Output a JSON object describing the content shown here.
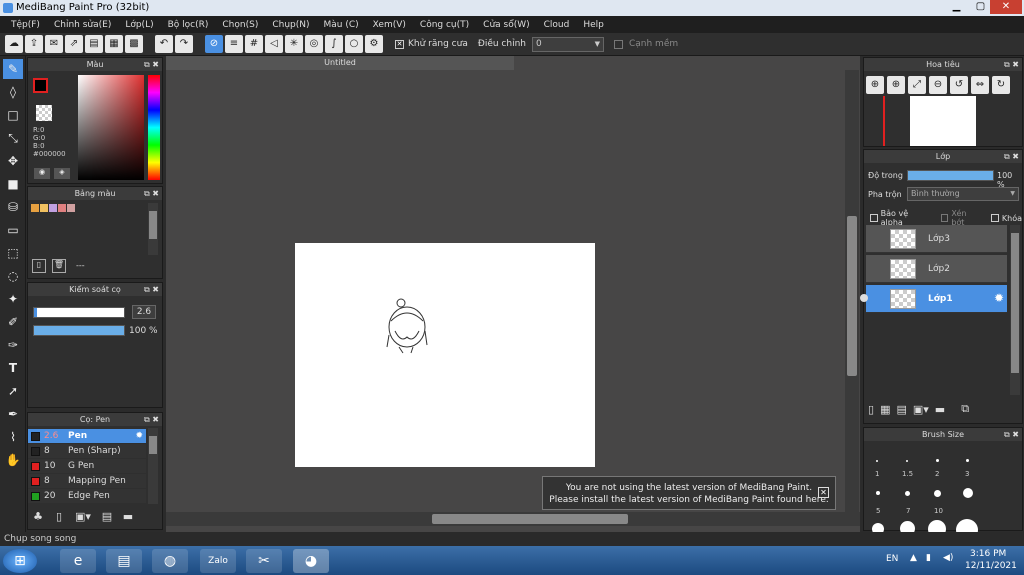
{
  "window": {
    "title": "MediBang Paint Pro (32bit)"
  },
  "menu": [
    "Tệp(F)",
    "Chỉnh sửa(E)",
    "Lớp(L)",
    "Bộ lọc(R)",
    "Chọn(S)",
    "Chụp(N)",
    "Màu (C)",
    "Xem(V)",
    "Công cụ(T)",
    "Cửa sổ(W)",
    "Cloud",
    "Help"
  ],
  "toolbar": {
    "antialias_label": "Khử răng cưa",
    "correction_label": "Điều chỉnh",
    "correction_value": "0",
    "soft_edge_label": "Cạnh mềm"
  },
  "color_panel": {
    "title": "Màu",
    "r": "R:0",
    "g": "G:0",
    "b": "B:0",
    "hex": "#000000"
  },
  "palette_panel": {
    "title": "Bảng màu",
    "dash": "---"
  },
  "brush_control": {
    "title": "Kiểm soát cọ",
    "size": "2.6",
    "opacity": "100 %"
  },
  "brush_list": {
    "title": "Cọ: Pen",
    "items": [
      {
        "size": "2.6",
        "name": "Pen",
        "color": "#222222"
      },
      {
        "size": "8",
        "name": "Pen (Sharp)",
        "color": "#222222"
      },
      {
        "size": "10",
        "name": "G Pen",
        "color": "#e02020"
      },
      {
        "size": "8",
        "name": "Mapping Pen",
        "color": "#e02020"
      },
      {
        "size": "20",
        "name": "Edge Pen",
        "color": "#20a020"
      }
    ]
  },
  "canvas": {
    "tab": "Untitled"
  },
  "notice": {
    "line1": "You are not using the latest version of MediBang Paint.",
    "line2": "Please install the latest version of MediBang Paint found here."
  },
  "navigator": {
    "title": "Hoa tiêu"
  },
  "layer_panel": {
    "title": "Lớp",
    "opacity_label": "Độ trong",
    "opacity_value": "100 %",
    "blend_label": "Pha trộn",
    "blend_value": "Bình thường",
    "protect_alpha": "Bảo vệ alpha",
    "clipping": "Xén bớt",
    "lock": "Khóa",
    "layers": [
      "Lớp3",
      "Lớp2",
      "Lớp1"
    ]
  },
  "brush_size": {
    "title": "Brush Size",
    "labels": [
      "1",
      "1.5",
      "2",
      "3",
      "5",
      "7",
      "10"
    ]
  },
  "status": {
    "text": "Chụp song song"
  },
  "taskbar": {
    "lang": "EN",
    "time": "3:16 PM",
    "date": "12/11/2021",
    "zalo": "Zalo"
  },
  "colors": {
    "accent": "#4a90e2",
    "panel": "#2f2f2f",
    "canvas_bg": "#474646"
  }
}
